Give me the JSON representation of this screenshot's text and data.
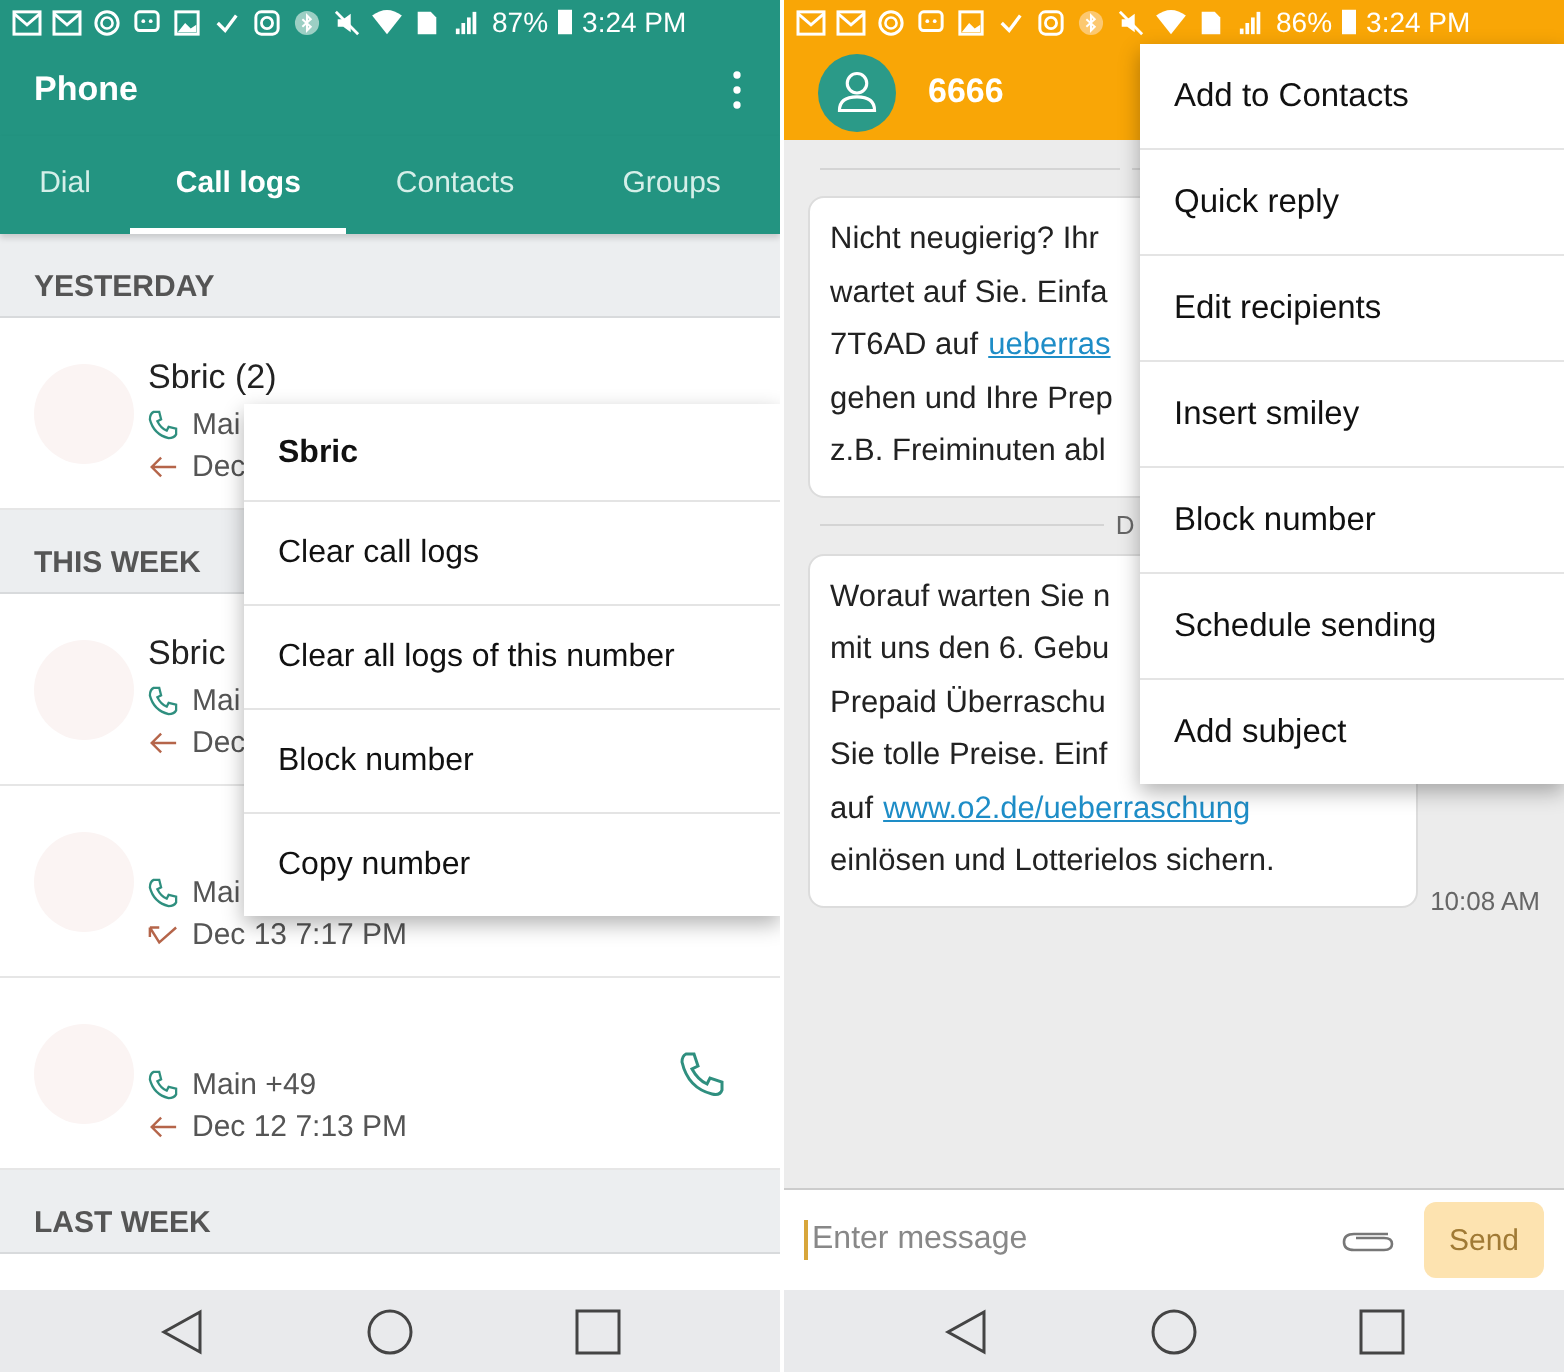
{
  "left_screen": {
    "status_bar": {
      "battery": "87%",
      "time": "3:24 PM"
    },
    "app_bar": {
      "title": "Phone"
    },
    "tabs": [
      {
        "label": "Dial",
        "selected": false
      },
      {
        "label": "Call logs",
        "selected": true
      },
      {
        "label": "Contacts",
        "selected": false
      },
      {
        "label": "Groups",
        "selected": false
      }
    ],
    "sections": [
      {
        "header": "YESTERDAY",
        "entries": [
          {
            "name": "Sbric (2)",
            "number": "Mai",
            "date": "Dec",
            "missed": false
          }
        ]
      },
      {
        "header": "THIS WEEK",
        "entries": [
          {
            "name": "Sbric",
            "number": "Mai",
            "date": "Dec",
            "missed": false
          },
          {
            "number": "Mai",
            "date": "Dec 13 7:17 PM",
            "missed": true
          },
          {
            "number": "Main +49",
            "date": "Dec 12 7:13 PM",
            "missed": false,
            "call_button": true
          }
        ]
      },
      {
        "header": "LAST WEEK"
      }
    ],
    "context_menu": {
      "title": "Sbric",
      "items": [
        "Clear call logs",
        "Clear all logs of this number",
        "Block number",
        "Copy number"
      ]
    }
  },
  "right_screen": {
    "status_bar": {
      "battery": "86%",
      "time": "3:24 PM"
    },
    "header": {
      "title": "6666"
    },
    "thread": [
      {
        "kind": "divider"
      },
      {
        "kind": "message",
        "lines": [
          {
            "text": "Nicht neugierig? Ihr"
          },
          {
            "text": "wartet auf Sie. Einfa"
          },
          {
            "text": "7T6AD auf",
            "link": "ueberras"
          },
          {
            "text": "gehen und Ihre Prep"
          },
          {
            "text": "z.B. Freiminuten abl"
          }
        ]
      },
      {
        "kind": "divider",
        "label": "D"
      },
      {
        "kind": "message",
        "lines": [
          {
            "text": "Worauf warten Sie n"
          },
          {
            "text": "mit uns den 6. Gebu"
          },
          {
            "text": "Prepaid Überraschu"
          },
          {
            "text": "Sie tolle Preise. Einf"
          },
          {
            "text": "auf",
            "link": "www.o2.de/ueberraschung"
          },
          {
            "text": "einlösen und Lotterielos sichern."
          }
        ],
        "time": "10:08 AM"
      }
    ],
    "overflow_menu": [
      "Add to Contacts",
      "Quick reply",
      "Edit recipients",
      "Insert smiley",
      "Block number",
      "Schedule sending",
      "Add subject"
    ],
    "composer": {
      "placeholder": "Enter message",
      "send": {
        "label": "Send",
        "disabled": true
      }
    }
  }
}
